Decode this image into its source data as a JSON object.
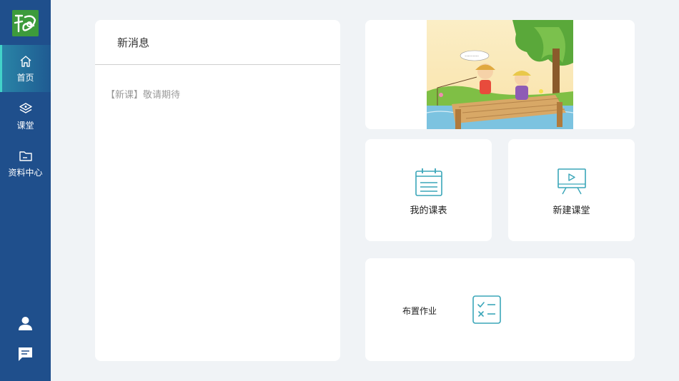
{
  "colors": {
    "sidebar": "#1f4f8c",
    "active_accent": "#42d3c9",
    "icon_teal": "#3aa6b9",
    "background": "#f0f3f6"
  },
  "sidebar": {
    "logo_icon": "logo-icon",
    "items": [
      {
        "label": "首页",
        "icon": "home-icon",
        "active": true
      },
      {
        "label": "课堂",
        "icon": "layers-icon",
        "active": false
      },
      {
        "label": "资料中心",
        "icon": "folder-icon",
        "active": false
      }
    ],
    "bottom_icons": [
      "user-icon",
      "message-icon"
    ]
  },
  "news": {
    "title": "新消息",
    "items": [
      "【新课】敬请期待"
    ]
  },
  "banner": {
    "image": "cartoon-children-fishing-on-pier"
  },
  "tiles": {
    "schedule": {
      "label": "我的课表",
      "icon": "calendar-icon"
    },
    "new_class": {
      "label": "新建课堂",
      "icon": "presentation-board-icon"
    },
    "homework": {
      "label": "布置作业",
      "icon": "checklist-icon"
    }
  }
}
